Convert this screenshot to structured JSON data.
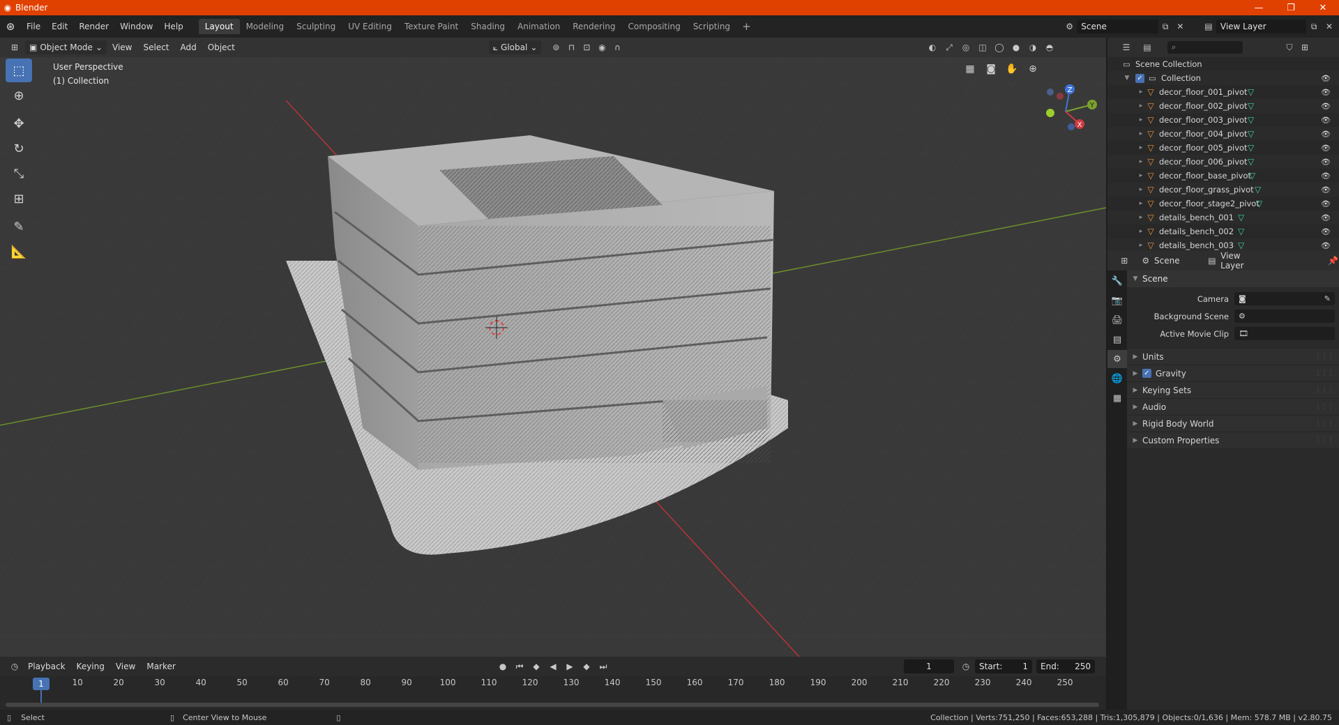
{
  "window": {
    "title": "Blender",
    "controls": [
      "—",
      "❐",
      "✕"
    ]
  },
  "menu": {
    "items": [
      "File",
      "Edit",
      "Render",
      "Window",
      "Help"
    ]
  },
  "workspaces": {
    "tabs": [
      "Layout",
      "Modeling",
      "Sculpting",
      "UV Editing",
      "Texture Paint",
      "Shading",
      "Animation",
      "Rendering",
      "Compositing",
      "Scripting"
    ],
    "active": "Layout"
  },
  "scene_selector": {
    "value": "Scene"
  },
  "view_layer_selector": {
    "value": "View Layer"
  },
  "viewport": {
    "mode": "Object Mode",
    "menus": [
      "View",
      "Select",
      "Add",
      "Object"
    ],
    "transform_orientation": "Global",
    "info_line1": "User Perspective",
    "info_line2": "(1) Collection",
    "gizmo_labels": {
      "z": "Z",
      "y": "Y",
      "x": "X"
    }
  },
  "outliner": {
    "root": "Scene Collection",
    "collection": "Collection",
    "items": [
      "decor_floor_001_pivot",
      "decor_floor_002_pivot",
      "decor_floor_003_pivot",
      "decor_floor_004_pivot",
      "decor_floor_005_pivot",
      "decor_floor_006_pivot",
      "decor_floor_base_pivot",
      "decor_floor_grass_pivot",
      "decor_floor_stage2_pivot",
      "details_bench_001",
      "details_bench_002",
      "details_bench_003"
    ]
  },
  "properties": {
    "header_scene": "Scene",
    "header_view_layer": "View Layer",
    "panel_title": "Scene",
    "fields": [
      {
        "label": "Camera"
      },
      {
        "label": "Background Scene"
      },
      {
        "label": "Active Movie Clip"
      }
    ],
    "subpanels": [
      "Units",
      "Gravity",
      "Keying Sets",
      "Audio",
      "Rigid Body World",
      "Custom Properties"
    ]
  },
  "timeline": {
    "menus": [
      "Playback",
      "Keying",
      "View",
      "Marker"
    ],
    "current_frame": "1",
    "start_label": "Start:",
    "start_value": "1",
    "end_label": "End:",
    "end_value": "250",
    "ruler": [
      "10",
      "20",
      "30",
      "40",
      "50",
      "60",
      "70",
      "80",
      "90",
      "100",
      "110",
      "120",
      "130",
      "140",
      "150",
      "160",
      "170",
      "180",
      "190",
      "200",
      "210",
      "220",
      "230",
      "240",
      "250"
    ]
  },
  "statusbar": {
    "left1": "Select",
    "left2": "Center View to Mouse",
    "right": "Collection | Verts:751,250 | Faces:653,288 | Tris:1,305,879 | Objects:0/1,636 | Mem: 578.7 MB | v2.80.75"
  },
  "colors": {
    "accent": "#4772b3",
    "titlebar": "#e04000",
    "x_axis": "#d0393f",
    "y_axis": "#7aa22e",
    "z_axis": "#3f74d8"
  }
}
